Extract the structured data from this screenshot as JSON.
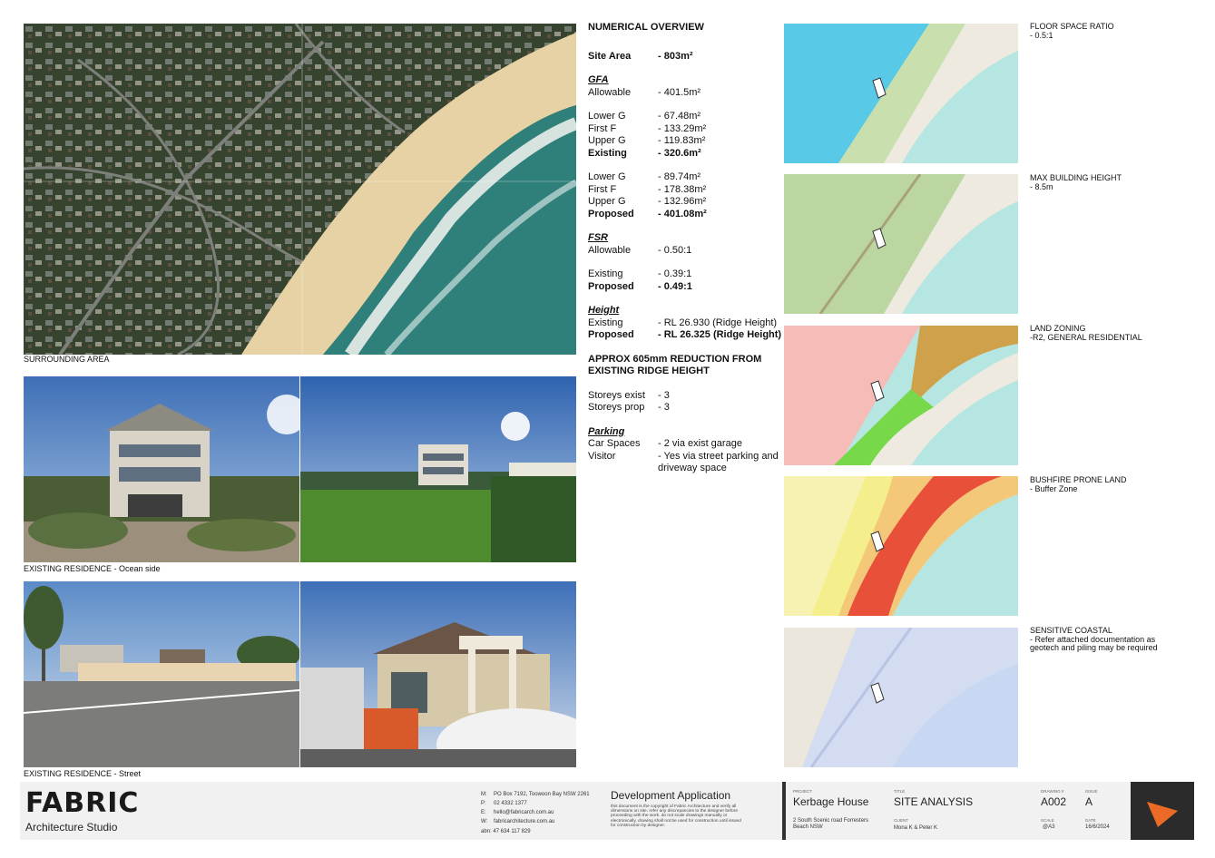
{
  "captions": {
    "aerial": "SURROUNDING AREA",
    "ocean": "EXISTING RESIDENCE - Ocean side",
    "street": "EXISTING RESIDENCE - Street"
  },
  "overview": {
    "title": "NUMERICAL OVERVIEW",
    "site_area_label": "Site Area",
    "site_area_value": "- 803m²",
    "gfa_heading": "GFA",
    "allowable_label": "Allowable",
    "gfa_allowable": "- 401.5m²",
    "lower_g_label": "Lower G",
    "first_f_label": "First F",
    "upper_g_label": "Upper G",
    "existing_label": "Existing",
    "proposed_label": "Proposed",
    "existing_lower_g": "- 67.48m²",
    "existing_first_f": "- 133.29m²",
    "existing_upper_g": "- 119.83m²",
    "existing_total": "- 320.6m²",
    "proposed_lower_g": "- 89.74m²",
    "proposed_first_f": "- 178.38m²",
    "proposed_upper_g": "- 132.96m²",
    "proposed_total": "- 401.08m²",
    "fsr_heading": "FSR",
    "fsr_allowable": "- 0.50:1",
    "fsr_existing": "- 0.39:1",
    "fsr_proposed": "- 0.49:1",
    "height_heading": "Height",
    "height_existing": "- RL 26.930 (Ridge Height)",
    "height_proposed": "- RL 26.325 (Ridge Height)",
    "reduction_note": "APPROX 605mm REDUCTION FROM EXISTING RIDGE HEIGHT",
    "storeys_exist_label": "Storeys exist",
    "storeys_exist_value": "- 3",
    "storeys_prop_label": "Storeys prop",
    "storeys_prop_value": "- 3",
    "parking_heading": "Parking",
    "car_spaces_label": "Car Spaces",
    "car_spaces_value": "- 2 via exist garage",
    "visitor_label": "Visitor",
    "visitor_value": "- Yes via street parking and driveway space"
  },
  "maps": [
    {
      "title": "FLOOR SPACE RATIO",
      "detail": "- 0.5:1"
    },
    {
      "title": "MAX BUILDING HEIGHT",
      "detail": "- 8.5m"
    },
    {
      "title": "LAND ZONING",
      "detail": "-R2, GENERAL RESIDENTIAL"
    },
    {
      "title": "BUSHFIRE PRONE LAND",
      "detail": "- Buffer Zone"
    },
    {
      "title": "SENSITIVE COASTAL",
      "detail": "- Refer attached documentation as geotech and piling may be required"
    }
  ],
  "footer": {
    "logo_text": "FABRIC",
    "studio": "Architecture Studio",
    "contact_keys": [
      "M:",
      "P:",
      "E:",
      "W:"
    ],
    "contact_values": [
      "PO Box 7192, Toowoon Bay NSW 2261",
      "02 4332 1377",
      "hello@fabricarch.com.au",
      "fabricarchitecture.com.au"
    ],
    "abn": "abn: 47 634 117 829",
    "da_title": "Development Application",
    "disclaimer": "this document is the copyright of Fabric Architecture and verify all dimensions on site. refer any discrepancies to the designer before proceeding with the work. do not scale drawings manually or electronically. drawing shall not be used for construction until issued for construction by designer.",
    "project_label": "PROJECT",
    "project": "Kerbage House",
    "address": "2 South Scenic road Forresters Beach NSW",
    "title_label": "TITLE",
    "title": "SITE ANALYSIS",
    "client_label": "CLIENT",
    "client": "Mona K & Peter K",
    "drawing_label": "DRAWING #",
    "drawing": "A002",
    "issue_label": "ISSUE",
    "issue": "A",
    "scale_label": "SCALE",
    "scale": "@A3",
    "date_label": "DATE",
    "date": "16/6/2024"
  }
}
